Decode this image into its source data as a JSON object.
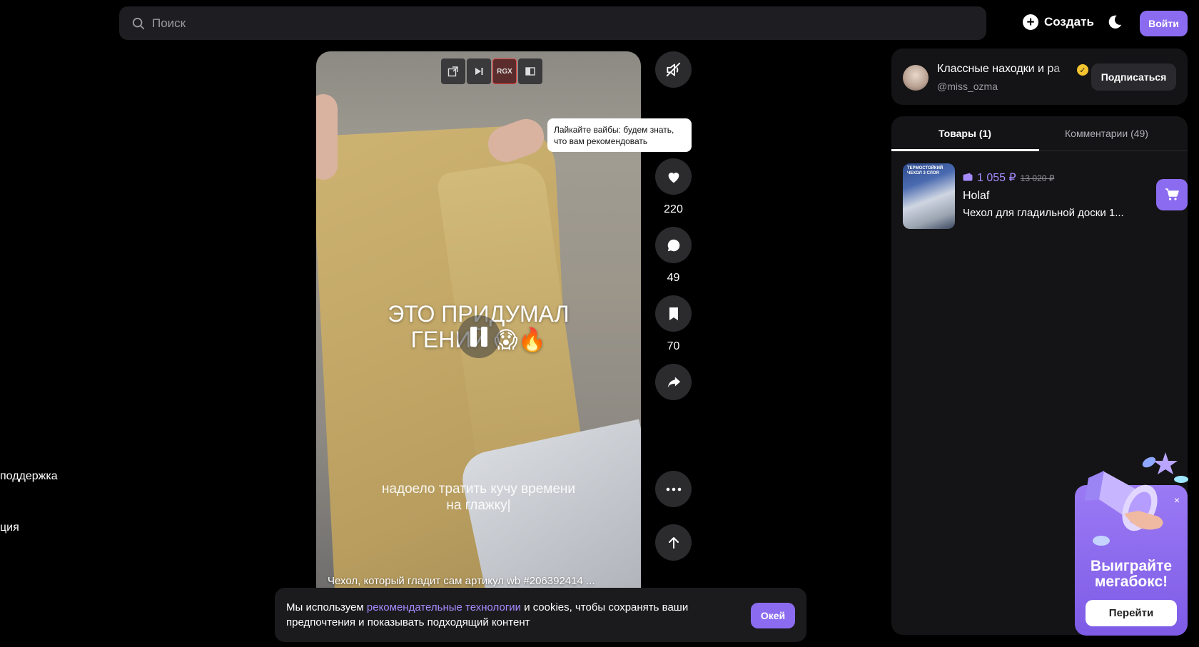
{
  "header": {
    "search_placeholder": "Поиск",
    "create_label": "Создать",
    "login_label": "Войти"
  },
  "sidebar": {
    "items": [
      {
        "label": "поддержка"
      },
      {
        "label": "ция"
      }
    ]
  },
  "video": {
    "toolbar": {
      "rgx_label": "RGX"
    },
    "overlay_line1": "ЭТО ПРИДУМАЛ",
    "overlay_line2": "ГЕНИЙ 😱🔥",
    "subtitle_line1": "надоело тратить кучу времени",
    "subtitle_line2": "на глажку|",
    "caption": "Чехол, который гладит сам артикул wb #206392414 ..."
  },
  "actions": {
    "tooltip": "Лайкайте вайбы: будем знать, что вам рекомендовать",
    "likes": "220",
    "comments": "49",
    "saves": "70"
  },
  "author": {
    "name": "Классные находки и ра",
    "handle": "@miss_ozma",
    "subscribe_label": "Подписаться"
  },
  "panel": {
    "tabs": [
      {
        "label": "Товары (1)"
      },
      {
        "label": "Комментарии (49)"
      }
    ],
    "products": [
      {
        "thumb_text": "ТЕРМОСТОЙКИЙ ЧЕХОЛ 3 СЛОЯ",
        "price": "1 055 ₽",
        "old_price": "13 020 ₽",
        "brand": "Holaf",
        "name": "Чехол для гладильной доски 1..."
      }
    ]
  },
  "promo": {
    "title_line1": "Выиграйте",
    "title_line2": "мегабокс!",
    "button_label": "Перейти",
    "close_glyph": "×"
  },
  "cookie": {
    "text_before": "Мы используем ",
    "link_text": "рекомендательные технологии",
    "text_after": " и cookies, чтобы сохранять ваши предпочтения и показывать подходящий контент",
    "ok_label": "Окей"
  },
  "colors": {
    "accent": "#8b6cf0",
    "price": "#a68bff",
    "verified": "#f4c430"
  }
}
